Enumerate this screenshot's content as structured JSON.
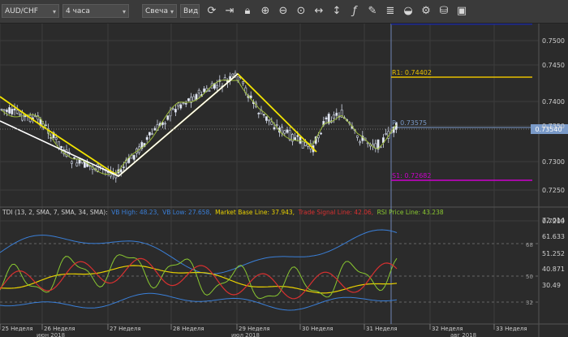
{
  "toolbar": {
    "symbol": "AUD/CHF",
    "timeframe": "4 часа",
    "chart_type": "Свеча",
    "view": "Вид",
    "icons": [
      "refresh-icon",
      "scroll-to-end-icon",
      "lock-icon",
      "zoom-in-icon",
      "zoom-out-icon",
      "zoom-fit-icon",
      "move-horizontal-icon",
      "move-vertical-icon",
      "function-icon",
      "indicator-icon",
      "layers-icon",
      "palette-icon",
      "settings-icon",
      "paint-bucket-icon",
      "screenshot-icon"
    ]
  },
  "price_axis": {
    "ticks": [
      "0.7500",
      "0.7450",
      "0.7400",
      "0.7350",
      "0.7300",
      "0.7250",
      "0.7200"
    ],
    "current_price": "0.73540"
  },
  "levels": {
    "r1_label": "R1: 0.74402",
    "pivot_label": "P: 0.73575",
    "s1_label": "S1: 0.72682",
    "r1_color": "#e8c000",
    "s1_color": "#cc00cc",
    "pivot_color": "#7a9ac8",
    "r2_color": "#1b2a9a"
  },
  "indicator": {
    "title": "TDI (13, 2, SMA, 7, SMA, 34, SMA):",
    "vb_high": "VB High: 48.23,",
    "vb_low": "VB Low: 27.658,",
    "market_base": "Market Base Line: 37.943,",
    "trade_signal": "Trade Signal Line: 42.06,",
    "rsi_price": "RSI Price Line: 43.238",
    "axis_ticks": [
      "72.014",
      "61.633",
      "51.252",
      "40.871",
      "30.49"
    ],
    "level_marks": [
      "68",
      "50",
      "32"
    ],
    "colors": {
      "vb": "#3a7fd8",
      "market_base": "#e8d000",
      "trade_signal": "#d83030",
      "rsi_price": "#8ac830"
    }
  },
  "time_axis": {
    "weeks": [
      "25 Неделя",
      "26 Неделя",
      "27 Неделя",
      "28 Неделя",
      "29 Неделя",
      "30 Неделя",
      "31 Неделя",
      "32 Неделя",
      "33 Неделя"
    ],
    "months": [
      "июн 2018",
      "июл 2018",
      "авг 2018"
    ]
  }
}
